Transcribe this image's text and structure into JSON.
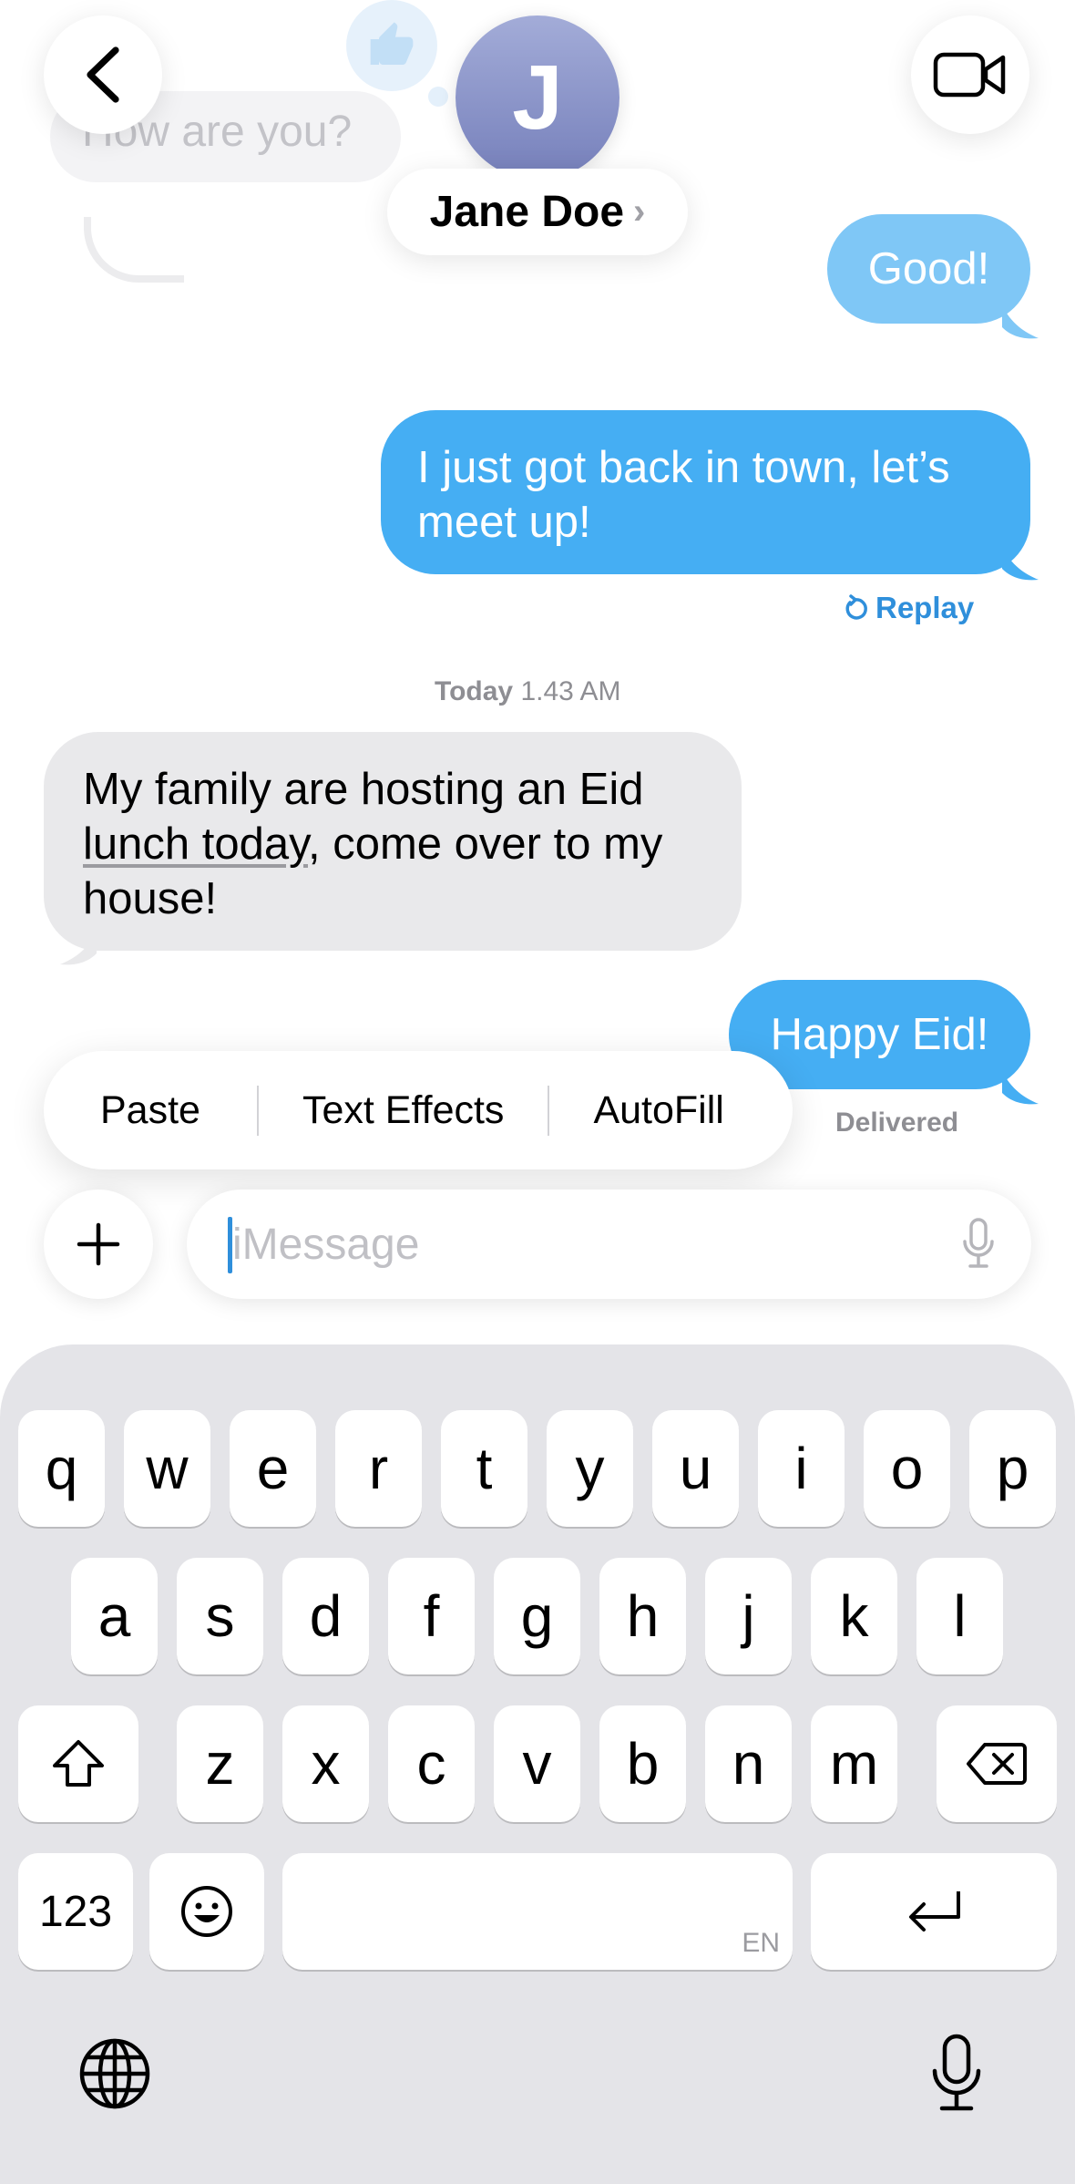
{
  "header": {
    "contact_name": "Jane Doe",
    "avatar_initial": "J",
    "name_chevron": "›"
  },
  "background_message": "How are you?",
  "messages": [
    {
      "direction": "sent",
      "text": "Good!"
    },
    {
      "direction": "sent",
      "text": "I just got back in town, let’s meet up!",
      "lines": [
        "I just got back in town, let’s",
        "meet up!"
      ]
    },
    {
      "direction": "received",
      "lines": [
        "My family are hosting an Eid",
        "lunch today",
        ", come over to my",
        "house!"
      ]
    },
    {
      "direction": "sent",
      "text": "Happy Eid!"
    }
  ],
  "replay_label": "Replay",
  "timestamp": {
    "day": "Today",
    "time": "1.43 AM"
  },
  "delivered_label": "Delivered",
  "edit_menu": [
    "Paste",
    "Text Effects",
    "AutoFill"
  ],
  "input": {
    "placeholder": "iMessage"
  },
  "keyboard": {
    "row1": [
      "q",
      "w",
      "e",
      "r",
      "t",
      "y",
      "u",
      "i",
      "o",
      "p"
    ],
    "row2": [
      "a",
      "s",
      "d",
      "f",
      "g",
      "h",
      "j",
      "k",
      "l"
    ],
    "row3": [
      "z",
      "x",
      "c",
      "v",
      "b",
      "n",
      "m"
    ],
    "numbers_key": "123",
    "language_label": "EN",
    "icons": [
      "shift-icon",
      "delete-icon",
      "emoji-icon",
      "return-icon",
      "globe-icon",
      "dictation-icon"
    ]
  },
  "colors": {
    "sent_bubble": "#45aef3",
    "received_bubble": "#e9e9eb",
    "accent": "#2f8fdb",
    "keyboard_bg": "#e4e4e8"
  }
}
